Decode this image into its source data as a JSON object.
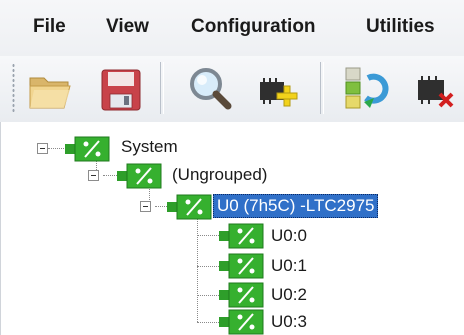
{
  "menu": {
    "file": "File",
    "view": "View",
    "configuration": "Configuration",
    "utilities": "Utilities"
  },
  "toolbar": {
    "buttons": [
      {
        "icon": "open-folder-icon"
      },
      {
        "icon": "save-disk-icon"
      },
      {
        "icon": "search-magnifier-icon"
      },
      {
        "icon": "add-device-icon"
      },
      {
        "icon": "refresh-devices-icon"
      },
      {
        "icon": "remove-device-icon"
      }
    ]
  },
  "tree": {
    "root": "System",
    "group": "(Ungrouped)",
    "device": "U0 (7h5C) -LTC2975",
    "channels": [
      "U0:0",
      "U0:1",
      "U0:2",
      "U0:3"
    ]
  },
  "colors": {
    "selection": "#3070c8",
    "device_green": "#2e9e2a"
  }
}
